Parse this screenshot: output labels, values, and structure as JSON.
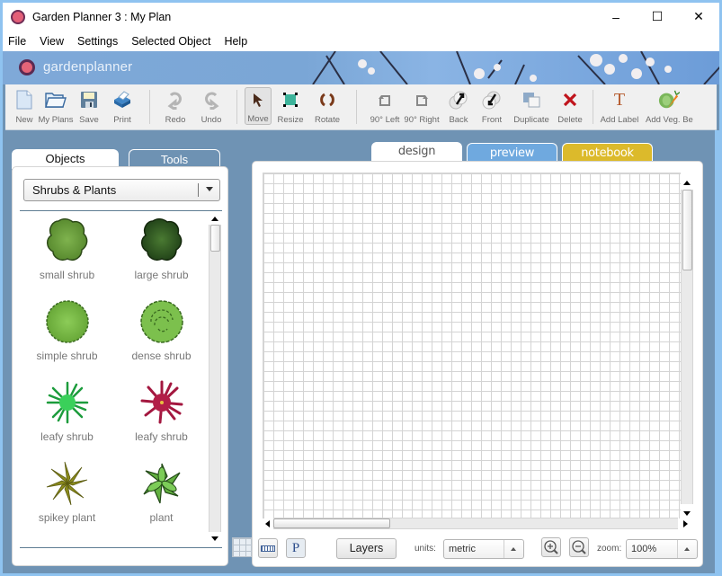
{
  "window": {
    "title": "Garden Planner 3 : My  Plan",
    "controls": {
      "minimize": "–",
      "maximize": "☐",
      "close": "✕"
    }
  },
  "menu": [
    "File",
    "View",
    "Settings",
    "Selected Object",
    "Help"
  ],
  "banner": {
    "brand": "gardenplanner"
  },
  "toolbar": {
    "groups": [
      [
        {
          "id": "new",
          "label": "New",
          "icon": "new-document-icon"
        },
        {
          "id": "my-plans",
          "label": "My Plans",
          "icon": "folder-icon"
        },
        {
          "id": "save",
          "label": "Save",
          "icon": "floppy-disk-icon"
        },
        {
          "id": "print",
          "label": "Print",
          "icon": "printer-icon"
        }
      ],
      [
        {
          "id": "redo",
          "label": "Redo",
          "icon": "redo-icon"
        },
        {
          "id": "undo",
          "label": "Undo",
          "icon": "undo-icon"
        }
      ],
      [
        {
          "id": "move",
          "label": "Move",
          "icon": "arrow-cursor-icon",
          "active": true
        },
        {
          "id": "resize",
          "label": "Resize",
          "icon": "resize-icon"
        },
        {
          "id": "rotate",
          "label": "Rotate",
          "icon": "rotate-icon"
        }
      ],
      [
        {
          "id": "rotate-left",
          "label": "90° Left",
          "icon": "rotate-left-icon"
        },
        {
          "id": "rotate-right",
          "label": "90° Right",
          "icon": "rotate-right-icon"
        },
        {
          "id": "back",
          "label": "Back",
          "icon": "send-back-icon"
        },
        {
          "id": "front",
          "label": "Front",
          "icon": "bring-front-icon"
        },
        {
          "id": "duplicate",
          "label": "Duplicate",
          "icon": "duplicate-icon"
        },
        {
          "id": "delete",
          "label": "Delete",
          "icon": "delete-x-icon"
        }
      ],
      [
        {
          "id": "add-label",
          "label": "Add Label",
          "icon": "text-t-icon"
        },
        {
          "id": "add-veg-bed",
          "label": "Add Veg. Be",
          "icon": "vegetable-icon"
        }
      ]
    ]
  },
  "left_panel": {
    "tabs": {
      "objects": "Objects",
      "tools": "Tools"
    },
    "category": "Shrubs & Plants",
    "items": [
      {
        "label": "small shrub",
        "icon": "small-shrub-icon",
        "color": "#6a9e3c"
      },
      {
        "label": "large shrub",
        "icon": "large-shrub-icon",
        "color": "#2f5a1d"
      },
      {
        "label": "simple shrub",
        "icon": "simple-shrub-icon",
        "color": "#74b543"
      },
      {
        "label": "dense shrub",
        "icon": "dense-shrub-icon",
        "color": "#7cc04d"
      },
      {
        "label": "leafy shrub",
        "icon": "leafy-shrub-green-icon",
        "color": "#25c04a"
      },
      {
        "label": "leafy shrub",
        "icon": "leafy-shrub-red-icon",
        "color": "#a3173f"
      },
      {
        "label": "spikey plant",
        "icon": "spikey-plant-icon",
        "color": "#8c8c1c"
      },
      {
        "label": "plant",
        "icon": "plant-icon",
        "color": "#62b040"
      }
    ]
  },
  "view_tabs": {
    "design": "design",
    "preview": "preview",
    "notebook": "notebook"
  },
  "bottom_bar": {
    "layers": "Layers",
    "units_label": "units:",
    "units_value": "metric",
    "zoom_label": "zoom:",
    "zoom_value": "100%",
    "p_button": "P"
  },
  "colors": {
    "background": "#6f93b4",
    "preview_tab": "#6fa9df",
    "notebook_tab": "#dcba2b",
    "delete_red": "#c0141c"
  }
}
